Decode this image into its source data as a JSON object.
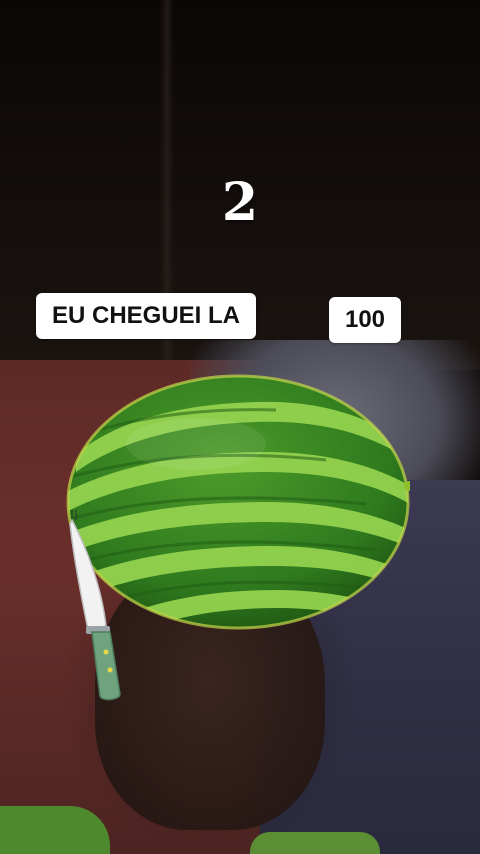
{
  "game": {
    "round_number": "2",
    "left_choice_label": "EU CHEGUEI LA",
    "right_choice_label": "100"
  },
  "objects": {
    "fruit": "watermelon",
    "tool": "knife"
  },
  "colors": {
    "label_background": "#ffffff",
    "label_text": "#111111",
    "round_text": "#ffffff",
    "watermelon_dark": "#2f7a1e",
    "watermelon_light": "#8fd14a",
    "knife_blade": "#f2f2f2",
    "knife_handle": "#6fa37e"
  }
}
